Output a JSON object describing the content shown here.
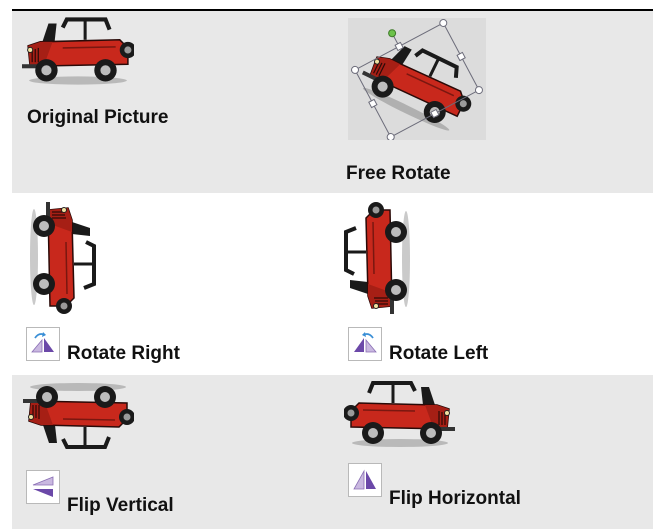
{
  "table": {
    "original_label": "Original Picture",
    "free_rotate_label": "Free Rotate",
    "rotate_right_label": "Rotate Right",
    "rotate_left_label": "Rotate Left",
    "flip_vertical_label": "Flip Vertical",
    "flip_horizontal_label": "Flip Horizontal"
  },
  "icons": {
    "jeep": "jeep-picture",
    "rotate_right": "rotate-right-icon",
    "rotate_left": "rotate-left-icon",
    "flip_vertical": "flip-vertical-icon",
    "flip_horizontal": "flip-horizontal-icon"
  },
  "colors": {
    "row_shade": "#e8e8e8",
    "jeep_body": "#c8281c",
    "selection_handle": "#6cc24a"
  }
}
